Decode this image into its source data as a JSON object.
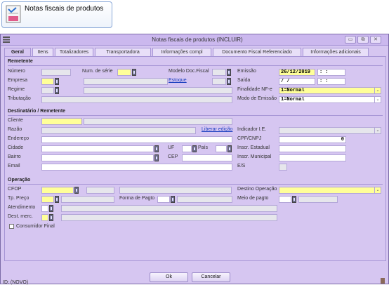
{
  "launcher": {
    "label": "Notas fiscais de produtos"
  },
  "window": {
    "title": "Notas fiscais de produtos (INCLUIR)",
    "min": "▭",
    "max": "⧉",
    "close": "✕"
  },
  "tabs": [
    "Geral",
    "Itens",
    "Totalizadores",
    "Transportadora",
    "Informações compl",
    "Documento Fiscal Referenciado",
    "Informações adicionais"
  ],
  "remetente": {
    "title": "Remetente",
    "numero": "Número",
    "num_serie": "Num. de série",
    "modelo": "Modelo Doc.Fiscal",
    "emissao": "Emissão",
    "emissao_value": "26/12/2019",
    "emissao_hora": " :  : ",
    "empresa": "Empresa",
    "estoque": "Estoque",
    "saida": "Saída",
    "saida_value": " /  / ",
    "saida_hora": " :  : ",
    "regime": "Regime",
    "finalidade": "Finalidade NF-e",
    "finalidade_value": "1=Normal",
    "tributacao": "Tributação",
    "modo": "Modo de Emissão",
    "modo_value": "1=Normal"
  },
  "destinatario": {
    "title": "Destinatário / Remetente",
    "cliente": "Cliente",
    "razao": "Razão",
    "liberar": "Liberar edição",
    "indicador": "Indicador I.E.",
    "endereco": "Endereço",
    "cpf": "CPF/CNPJ",
    "cpf_value": "0",
    "cidade": "Cidade",
    "uf": "UF",
    "pais": "País",
    "insc_estadual": "Inscr. Estadual",
    "bairro": "Bairro",
    "cep": "CEP",
    "insc_municipal": "Inscr. Municipal",
    "email": "Email",
    "es": "E/S"
  },
  "operacao": {
    "title": "Operação",
    "cfop": "CFOP",
    "destino": "Destino Operação",
    "tp_preco": "Tp. Preço",
    "forma_pagto": "Forma de Pagto",
    "meio_pagto": "Meio de pagto",
    "atendimento": "Atendimento",
    "dest_merc": "Dest. merc.",
    "consumidor": "Consumidor Final"
  },
  "buttons": {
    "ok": "Ok",
    "cancel": "Cancelar"
  },
  "status": "ID: (NOVO)"
}
